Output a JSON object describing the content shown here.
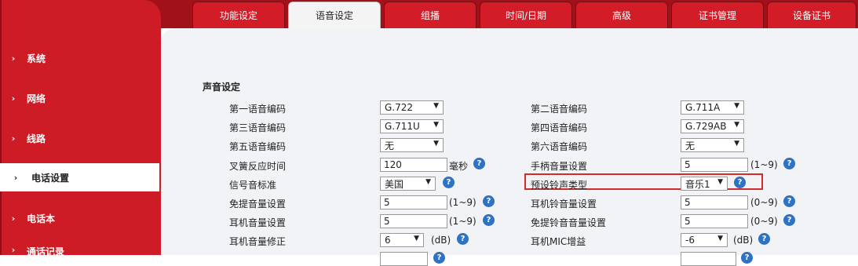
{
  "tabs": [
    "功能设定",
    "语音设定",
    "组播",
    "时间/日期",
    "高级",
    "证书管理",
    "设备证书"
  ],
  "active_tab": "语音设定",
  "sidebar": [
    {
      "label": "系统",
      "active": false
    },
    {
      "label": "网络",
      "active": false
    },
    {
      "label": "线路",
      "active": false
    },
    {
      "label": "电话设置",
      "active": true
    },
    {
      "label": "电话本",
      "active": false
    },
    {
      "label": "通话记录",
      "active": false
    }
  ],
  "section_title": "声音设定",
  "left_rows": [
    {
      "label": "第一语音编码",
      "type": "select",
      "value": "G.722"
    },
    {
      "label": "第三语音编码",
      "type": "select",
      "value": "G.711U"
    },
    {
      "label": "第五语音编码",
      "type": "select",
      "value": "无"
    },
    {
      "label": "叉簧反应时间",
      "type": "input",
      "value": "120",
      "unit": "毫秒"
    },
    {
      "label": "信号音标准",
      "type": "select",
      "value": "美国"
    },
    {
      "label": "免提音量设置",
      "type": "input",
      "value": "5",
      "unit": "(1~9)"
    },
    {
      "label": "耳机音量设置",
      "type": "input",
      "value": "5",
      "unit": "(1~9)"
    },
    {
      "label": "耳机音量修正",
      "type": "select",
      "value": "6",
      "unit": "(dB)"
    },
    {
      "label": "",
      "type": "select",
      "value": ""
    }
  ],
  "right_rows": [
    {
      "label": "第二语音编码",
      "type": "select",
      "value": "G.711A"
    },
    {
      "label": "第四语音编码",
      "type": "select",
      "value": "G.729AB"
    },
    {
      "label": "第六语音编码",
      "type": "select",
      "value": "无"
    },
    {
      "label": "手柄音量设置",
      "type": "input",
      "value": "5",
      "unit": "(1~9)"
    },
    {
      "label": "预设铃声类型",
      "type": "select",
      "value": "音乐1"
    },
    {
      "label": "耳机铃音量设置",
      "type": "input",
      "value": "5",
      "unit": "(0~9)"
    },
    {
      "label": "免提铃音音量设置",
      "type": "input",
      "value": "5",
      "unit": "(0~9)"
    },
    {
      "label": "耳机MIC增益",
      "type": "select",
      "value": "-6",
      "unit": "(dB)"
    },
    {
      "label": "",
      "type": "select",
      "value": ""
    }
  ],
  "colors": {
    "brand_red": "#d21c27",
    "dark_red": "#a1111a",
    "help_blue": "#2d72c4",
    "highlight": "#d22b2b"
  }
}
